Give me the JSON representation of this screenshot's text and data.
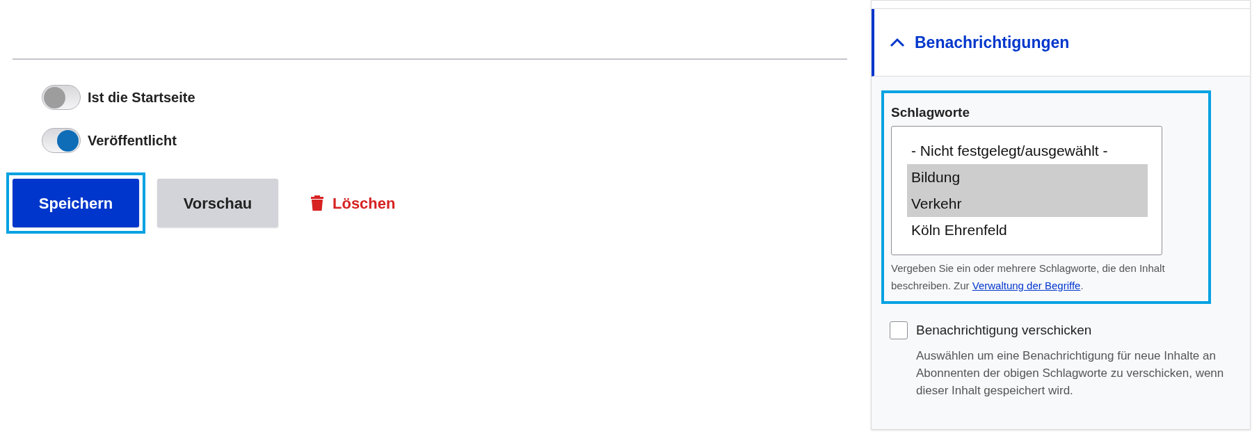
{
  "toggles": [
    {
      "label": "Ist die Startseite",
      "on": false
    },
    {
      "label": "Veröffentlicht",
      "on": true
    }
  ],
  "actions": [
    {
      "kind": "primary",
      "label": "Speichern",
      "focused": true
    },
    {
      "kind": "secondary",
      "label": "Vorschau",
      "focused": false
    },
    {
      "kind": "danger",
      "label": "Löschen",
      "focused": false
    }
  ],
  "sidebar": {
    "section": {
      "title": "Benachrichtigungen",
      "expanded": true
    },
    "tags_field": {
      "label": "Schlagworte",
      "focused": true,
      "options": [
        {
          "label": "- Nicht festgelegt/ausgewählt -",
          "selected": false
        },
        {
          "label": "Bildung",
          "selected": true
        },
        {
          "label": "Verkehr",
          "selected": true
        },
        {
          "label": "Köln Ehrenfeld",
          "selected": false
        }
      ],
      "description": "Vergeben Sie ein oder mehrere Schlagworte, die den Inhalt beschreiben. Zur",
      "link": "Verwaltung der Begriffe",
      "description_end": "."
    },
    "notify": {
      "label": "Benachrichtigung verschicken",
      "checked": false,
      "description": "Auswählen um eine Benachrichtigung für neue Inhalte an Abonnenten der obigen Schlagworte zu verschicken, wenn dieser Inhalt gespeichert wird."
    }
  }
}
